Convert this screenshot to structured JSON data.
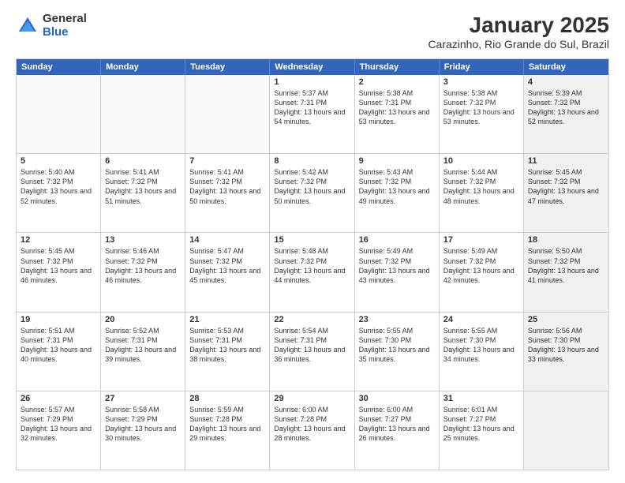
{
  "logo": {
    "general": "General",
    "blue": "Blue"
  },
  "title": "January 2025",
  "subtitle": "Carazinho, Rio Grande do Sul, Brazil",
  "days": [
    "Sunday",
    "Monday",
    "Tuesday",
    "Wednesday",
    "Thursday",
    "Friday",
    "Saturday"
  ],
  "weeks": [
    [
      {
        "day": "",
        "info": "",
        "empty": true
      },
      {
        "day": "",
        "info": "",
        "empty": true
      },
      {
        "day": "",
        "info": "",
        "empty": true
      },
      {
        "day": "1",
        "info": "Sunrise: 5:37 AM\nSunset: 7:31 PM\nDaylight: 13 hours\nand 54 minutes.",
        "empty": false
      },
      {
        "day": "2",
        "info": "Sunrise: 5:38 AM\nSunset: 7:31 PM\nDaylight: 13 hours\nand 53 minutes.",
        "empty": false
      },
      {
        "day": "3",
        "info": "Sunrise: 5:38 AM\nSunset: 7:32 PM\nDaylight: 13 hours\nand 53 minutes.",
        "empty": false
      },
      {
        "day": "4",
        "info": "Sunrise: 5:39 AM\nSunset: 7:32 PM\nDaylight: 13 hours\nand 52 minutes.",
        "empty": false,
        "shaded": true
      }
    ],
    [
      {
        "day": "5",
        "info": "Sunrise: 5:40 AM\nSunset: 7:32 PM\nDaylight: 13 hours\nand 52 minutes.",
        "empty": false
      },
      {
        "day": "6",
        "info": "Sunrise: 5:41 AM\nSunset: 7:32 PM\nDaylight: 13 hours\nand 51 minutes.",
        "empty": false
      },
      {
        "day": "7",
        "info": "Sunrise: 5:41 AM\nSunset: 7:32 PM\nDaylight: 13 hours\nand 50 minutes.",
        "empty": false
      },
      {
        "day": "8",
        "info": "Sunrise: 5:42 AM\nSunset: 7:32 PM\nDaylight: 13 hours\nand 50 minutes.",
        "empty": false
      },
      {
        "day": "9",
        "info": "Sunrise: 5:43 AM\nSunset: 7:32 PM\nDaylight: 13 hours\nand 49 minutes.",
        "empty": false
      },
      {
        "day": "10",
        "info": "Sunrise: 5:44 AM\nSunset: 7:32 PM\nDaylight: 13 hours\nand 48 minutes.",
        "empty": false
      },
      {
        "day": "11",
        "info": "Sunrise: 5:45 AM\nSunset: 7:32 PM\nDaylight: 13 hours\nand 47 minutes.",
        "empty": false,
        "shaded": true
      }
    ],
    [
      {
        "day": "12",
        "info": "Sunrise: 5:45 AM\nSunset: 7:32 PM\nDaylight: 13 hours\nand 46 minutes.",
        "empty": false
      },
      {
        "day": "13",
        "info": "Sunrise: 5:46 AM\nSunset: 7:32 PM\nDaylight: 13 hours\nand 46 minutes.",
        "empty": false
      },
      {
        "day": "14",
        "info": "Sunrise: 5:47 AM\nSunset: 7:32 PM\nDaylight: 13 hours\nand 45 minutes.",
        "empty": false
      },
      {
        "day": "15",
        "info": "Sunrise: 5:48 AM\nSunset: 7:32 PM\nDaylight: 13 hours\nand 44 minutes.",
        "empty": false
      },
      {
        "day": "16",
        "info": "Sunrise: 5:49 AM\nSunset: 7:32 PM\nDaylight: 13 hours\nand 43 minutes.",
        "empty": false
      },
      {
        "day": "17",
        "info": "Sunrise: 5:49 AM\nSunset: 7:32 PM\nDaylight: 13 hours\nand 42 minutes.",
        "empty": false
      },
      {
        "day": "18",
        "info": "Sunrise: 5:50 AM\nSunset: 7:32 PM\nDaylight: 13 hours\nand 41 minutes.",
        "empty": false,
        "shaded": true
      }
    ],
    [
      {
        "day": "19",
        "info": "Sunrise: 5:51 AM\nSunset: 7:31 PM\nDaylight: 13 hours\nand 40 minutes.",
        "empty": false
      },
      {
        "day": "20",
        "info": "Sunrise: 5:52 AM\nSunset: 7:31 PM\nDaylight: 13 hours\nand 39 minutes.",
        "empty": false
      },
      {
        "day": "21",
        "info": "Sunrise: 5:53 AM\nSunset: 7:31 PM\nDaylight: 13 hours\nand 38 minutes.",
        "empty": false
      },
      {
        "day": "22",
        "info": "Sunrise: 5:54 AM\nSunset: 7:31 PM\nDaylight: 13 hours\nand 36 minutes.",
        "empty": false
      },
      {
        "day": "23",
        "info": "Sunrise: 5:55 AM\nSunset: 7:30 PM\nDaylight: 13 hours\nand 35 minutes.",
        "empty": false
      },
      {
        "day": "24",
        "info": "Sunrise: 5:55 AM\nSunset: 7:30 PM\nDaylight: 13 hours\nand 34 minutes.",
        "empty": false
      },
      {
        "day": "25",
        "info": "Sunrise: 5:56 AM\nSunset: 7:30 PM\nDaylight: 13 hours\nand 33 minutes.",
        "empty": false,
        "shaded": true
      }
    ],
    [
      {
        "day": "26",
        "info": "Sunrise: 5:57 AM\nSunset: 7:29 PM\nDaylight: 13 hours\nand 32 minutes.",
        "empty": false
      },
      {
        "day": "27",
        "info": "Sunrise: 5:58 AM\nSunset: 7:29 PM\nDaylight: 13 hours\nand 30 minutes.",
        "empty": false
      },
      {
        "day": "28",
        "info": "Sunrise: 5:59 AM\nSunset: 7:28 PM\nDaylight: 13 hours\nand 29 minutes.",
        "empty": false
      },
      {
        "day": "29",
        "info": "Sunrise: 6:00 AM\nSunset: 7:28 PM\nDaylight: 13 hours\nand 28 minutes.",
        "empty": false
      },
      {
        "day": "30",
        "info": "Sunrise: 6:00 AM\nSunset: 7:27 PM\nDaylight: 13 hours\nand 26 minutes.",
        "empty": false
      },
      {
        "day": "31",
        "info": "Sunrise: 6:01 AM\nSunset: 7:27 PM\nDaylight: 13 hours\nand 25 minutes.",
        "empty": false
      },
      {
        "day": "",
        "info": "",
        "empty": true,
        "shaded": true
      }
    ]
  ]
}
